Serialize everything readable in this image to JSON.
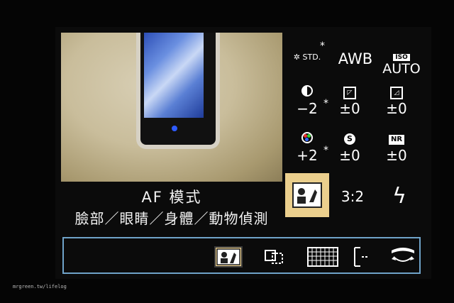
{
  "af_panel": {
    "title": "AF 模式",
    "subtitle": "臉部／眼睛／身體／動物偵測"
  },
  "quick_menu": {
    "photo_style": {
      "label": "STD.",
      "star": "*"
    },
    "white_balance": {
      "label": "AWB"
    },
    "iso": {
      "tag": "ISO",
      "label": "AUTO"
    },
    "contrast": {
      "value": "−2",
      "star": "*"
    },
    "highlight": {
      "value": "±0"
    },
    "shadow": {
      "value": "±0"
    },
    "saturation": {
      "value": "+2",
      "star": "*"
    },
    "sharpness": {
      "icon_letter": "S",
      "value": "±0"
    },
    "noise_reduction": {
      "icon_label": "NR",
      "value": "±0"
    },
    "aspect_ratio": {
      "label": "3:2"
    }
  },
  "af_mode_options": [
    {
      "icon": "face-animal-detect-icon",
      "selected": true
    },
    {
      "icon": "tracking-icon",
      "selected": false
    },
    {
      "icon": "225-area-icon",
      "selected": false
    },
    {
      "icon": "zone-icon",
      "selected": false
    },
    {
      "icon": "1-area-icon",
      "selected": false
    }
  ],
  "watermark": "mrgreen.tw/lifelog",
  "colors": {
    "highlight": "#ebcf8d",
    "frame": "#6fa3c9"
  }
}
